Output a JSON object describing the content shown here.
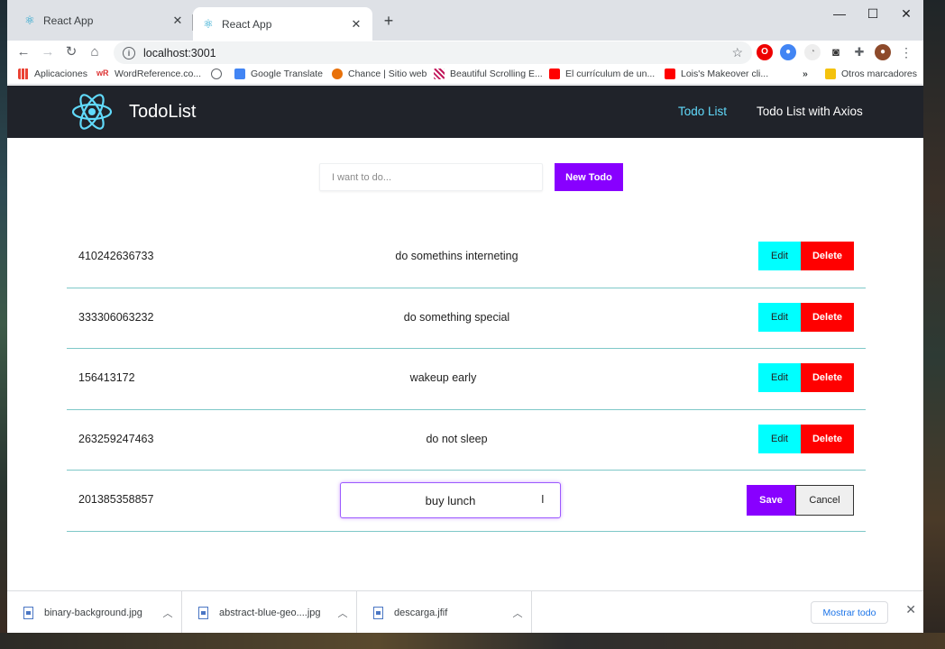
{
  "browser": {
    "tabs": [
      {
        "title": "React App",
        "active": false
      },
      {
        "title": "React App",
        "active": true
      }
    ],
    "url": "localhost:3001",
    "bookmarks": [
      {
        "label": "Aplicaciones",
        "icon": "apps-grid-icon",
        "color": "#ea4335"
      },
      {
        "label": "WordReference.co...",
        "icon": "wordreference-icon",
        "color": "#d33"
      },
      {
        "label": "",
        "icon": "globe-icon",
        "color": "#5f6368"
      },
      {
        "label": "Google Translate",
        "icon": "translate-icon",
        "color": "#4285f4"
      },
      {
        "label": "Chance | Sitio web",
        "icon": "chance-icon",
        "color": "#e8710a"
      },
      {
        "label": "Beautiful Scrolling E...",
        "icon": "pattern-icon",
        "color": "#c2185b"
      },
      {
        "label": "El currículum de un...",
        "icon": "youtube-icon",
        "color": "#ff0000"
      },
      {
        "label": "Lois's Makeover cli...",
        "icon": "youtube-icon",
        "color": "#ff0000"
      },
      {
        "label": "»",
        "icon": "chevron-more-icon",
        "color": "#3c4043"
      },
      {
        "label": "Otros marcadores",
        "icon": "folder-icon",
        "color": "#f4c20d"
      }
    ]
  },
  "app": {
    "brand": "TodoList",
    "nav": {
      "todo_list": "Todo List",
      "todo_list_axios": "Todo List with Axios"
    },
    "new_todo": {
      "placeholder": "I want to do...",
      "button": "New Todo"
    },
    "todos": [
      {
        "id": "410242636733",
        "text": "do somethins interneting"
      },
      {
        "id": "333306063232",
        "text": "do something special"
      },
      {
        "id": "156413172",
        "text": "wakeup early"
      },
      {
        "id": "263259247463",
        "text": "do not sleep"
      }
    ],
    "editing_todo": {
      "id": "201385358857",
      "value": "buy lunch"
    },
    "labels": {
      "edit": "Edit",
      "delete": "Delete",
      "save": "Save",
      "cancel": "Cancel"
    },
    "colors": {
      "navbar": "#20232a",
      "react_blue": "#61dafb",
      "purple": "#8800ff",
      "cyan": "#00ffff",
      "red": "#ff0000"
    }
  },
  "downloads": {
    "items": [
      {
        "name": "binary-background.jpg"
      },
      {
        "name": "abstract-blue-geo....jpg"
      },
      {
        "name": "descarga.jfif"
      }
    ],
    "show_all": "Mostrar todo"
  }
}
